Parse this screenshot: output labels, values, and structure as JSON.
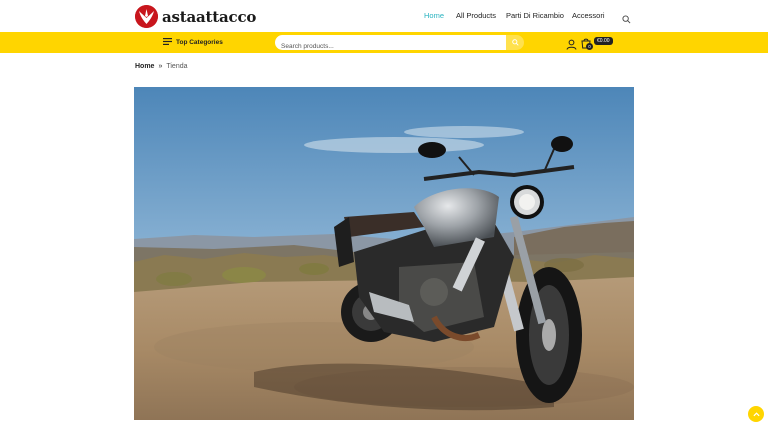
{
  "header": {
    "logo_text": "astaattacco",
    "nav": [
      {
        "label": "Home",
        "active": true
      },
      {
        "label": "All Products",
        "active": false
      },
      {
        "label": "Parti Di Ricambio",
        "active": false
      },
      {
        "label": "Accessori",
        "active": false
      }
    ],
    "search_icon": "search-icon"
  },
  "bar": {
    "top_categories_label": "Top Categories",
    "search_placeholder": "Search products...",
    "cart_count": "0",
    "cart_total": "€0.00"
  },
  "breadcrumb": {
    "home": "Home",
    "current": "Tienda"
  },
  "colors": {
    "accent_yellow": "#ffd500",
    "nav_active": "#2ab3c0",
    "brand_red": "#c8161d"
  },
  "hero": {
    "subject": "motorcycle"
  }
}
